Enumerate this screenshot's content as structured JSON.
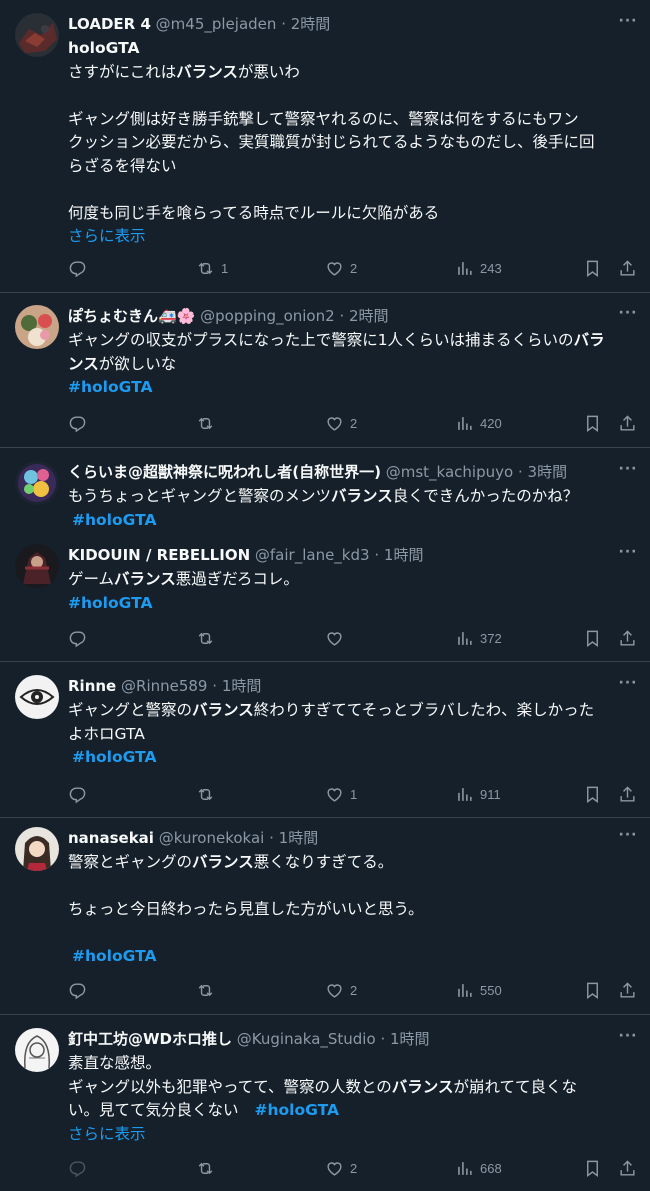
{
  "tweets": [
    {
      "name": "LOADER 4",
      "handle": "@m45_plejaden",
      "sep": "·",
      "time": "2時間",
      "quote_label": "holoGTA",
      "lines": [
        [
          "さすがにこれは",
          "バランス",
          "が悪いわ"
        ],
        [
          "ギャング側は好き勝手銃撃して警察ヤれるのに、警察は何をするにもワン"
        ],
        [
          "クッション必要だから、実質職質が封じられてるようなものだし、後手に回"
        ],
        [
          "らざるを得ない"
        ],
        [
          "何度も同じ手を喰らってる時点でルールに欠陥がある"
        ]
      ],
      "show_more": "さらに表示",
      "replies": "",
      "retweets": "1",
      "likes": "2",
      "views": "243"
    },
    {
      "name": "ぽちょむきん🚑🌸",
      "handle": "@popping_onion2",
      "sep": "·",
      "time": "2時間",
      "lines": [
        [
          "ギャングの収支がプラスになった上で警察に1人くらいは捕まるくらいの",
          "バラ"
        ],
        [
          "ンス",
          "が欲しいな"
        ]
      ],
      "hashtag": "#holoGTA",
      "replies": "",
      "retweets": "",
      "likes": "2",
      "views": "420"
    },
    {
      "name": "くらいま@超獣神祭に呪われし者(自称世界一)",
      "handle": "@mst_kachipuyo",
      "sep": "·",
      "time": "3時間",
      "lines": [
        [
          "もうちょっとギャングと警察のメンツ",
          "バランス",
          "良くできんかったのかね？"
        ]
      ],
      "hashtag": "#holoGTA"
    },
    {
      "name": "KIDOUIN / REBELLION",
      "handle": "@fair_lane_kd3",
      "sep": "·",
      "time": "1時間",
      "lines": [
        [
          "ゲーム",
          "バランス",
          "悪過ぎだろコレ。"
        ]
      ],
      "hashtag": "#holoGTA",
      "replies": "",
      "retweets": "",
      "likes": "",
      "views": "372"
    },
    {
      "name": "Rinne",
      "handle": "@Rinne589",
      "sep": "·",
      "time": "1時間",
      "lines": [
        [
          "ギャングと警察の",
          "バランス",
          "終わりすぎててそっとブラバしたわ、楽しかった"
        ],
        [
          "よホロGTA"
        ]
      ],
      "hashtag": "#holoGTA",
      "replies": "",
      "retweets": "",
      "likes": "1",
      "views": "911"
    },
    {
      "name": "nanasekai",
      "handle": "@kuronekokai",
      "sep": "·",
      "time": "1時間",
      "lines": [
        [
          "警察とギャングの",
          "バランス",
          "悪くなりすぎてる。"
        ],
        [
          "ちょっと今日終わったら見直した方がいいと思う。"
        ]
      ],
      "hashtag": "#holoGTA",
      "replies": "",
      "retweets": "",
      "likes": "2",
      "views": "550"
    },
    {
      "name": "釘中工坊@WDホロ推し",
      "handle": "@Kuginaka_Studio",
      "sep": "·",
      "time": "1時間",
      "lines": [
        [
          "素直な感想。"
        ],
        [
          "ギャング以外も犯罪やってて、警察の人数との",
          "バランス",
          "が崩れてて良くな"
        ],
        [
          "い。見てて気分良くない"
        ]
      ],
      "hashtag": "#holoGTA",
      "show_more": "さらに表示",
      "replies": "",
      "retweets": "",
      "likes": "2",
      "views": "668"
    }
  ],
  "more_label": "···",
  "icons": [
    "reply-icon",
    "retweet-icon",
    "like-icon",
    "views-icon",
    "bookmark-icon",
    "share-icon"
  ],
  "colors": {
    "background": "#15202b",
    "text": "#f7f9f9",
    "muted": "#8b98a5",
    "accent": "#1d9bf0",
    "divider": "#38444d"
  }
}
